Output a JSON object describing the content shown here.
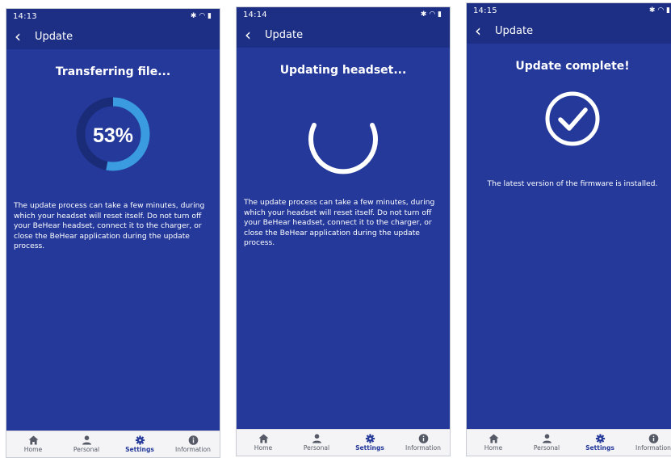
{
  "colors": {
    "background": "#24399a",
    "header": "#1d2f84",
    "progress_track": "#1a2c78",
    "progress_fill": "#3a9be0",
    "navbar": "#f4f4f6",
    "active_nav": "#24399a"
  },
  "screens": [
    {
      "status_time": "14:13",
      "title": "Update",
      "heading": "Transferring file...",
      "progress_percent": 53,
      "progress_label": "53%",
      "body": "The update process can take a few minutes, during which your headset will reset itself. Do not turn off your BeHear headset, connect it to the charger, or close the BeHear application during the update process."
    },
    {
      "status_time": "14:14",
      "title": "Update",
      "heading": "Updating headset...",
      "body": "The update process can take a few minutes, during which your headset will reset itself. Do not turn off your BeHear headset, connect it to the charger, or close the BeHear application during the update process."
    },
    {
      "status_time": "14:15",
      "title": "Update",
      "heading": "Update complete!",
      "body": "The latest version of the firmware is installed."
    }
  ],
  "nav": {
    "items": [
      {
        "label": "Home",
        "icon": "home-icon"
      },
      {
        "label": "Personal",
        "icon": "person-icon"
      },
      {
        "label": "Settings",
        "icon": "gear-icon"
      },
      {
        "label": "Information",
        "icon": "info-icon"
      }
    ],
    "active": "Settings"
  }
}
